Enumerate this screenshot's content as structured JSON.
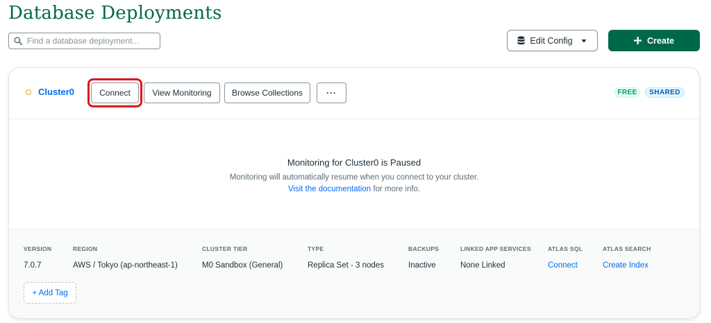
{
  "page": {
    "title": "Database Deployments"
  },
  "search": {
    "placeholder": "Find a database deployment..."
  },
  "toolbar": {
    "edit_config_label": "Edit Config",
    "create_label": "Create"
  },
  "cluster": {
    "name": "Cluster0",
    "buttons": {
      "connect": "Connect",
      "view_monitoring": "View Monitoring",
      "browse_collections": "Browse Collections",
      "more": "···"
    },
    "badges": {
      "free": "FREE",
      "shared": "SHARED"
    },
    "status_color": "#e8a33b",
    "highlight_color": "#e0151b"
  },
  "monitoring": {
    "title": "Monitoring for Cluster0 is Paused",
    "description": "Monitoring will automatically resume when you connect to your cluster.",
    "link_text": "Visit the documentation",
    "link_suffix": " for more info."
  },
  "meta": [
    {
      "label": "VERSION",
      "value": "7.0.7"
    },
    {
      "label": "REGION",
      "value": "AWS / Tokyo (ap-northeast-1)"
    },
    {
      "label": "CLUSTER TIER",
      "value": "M0 Sandbox (General)"
    },
    {
      "label": "TYPE",
      "value": "Replica Set - 3 nodes"
    },
    {
      "label": "BACKUPS",
      "value": "Inactive"
    },
    {
      "label": "LINKED APP SERVICES",
      "value": "None Linked"
    },
    {
      "label": "ATLAS SQL",
      "value": "Connect"
    },
    {
      "label": "ATLAS SEARCH",
      "value": "Create Index"
    }
  ],
  "tags": {
    "add_label": "+ Add Tag"
  },
  "colors": {
    "brand_green": "#00684a",
    "link_blue": "#016bf8"
  }
}
